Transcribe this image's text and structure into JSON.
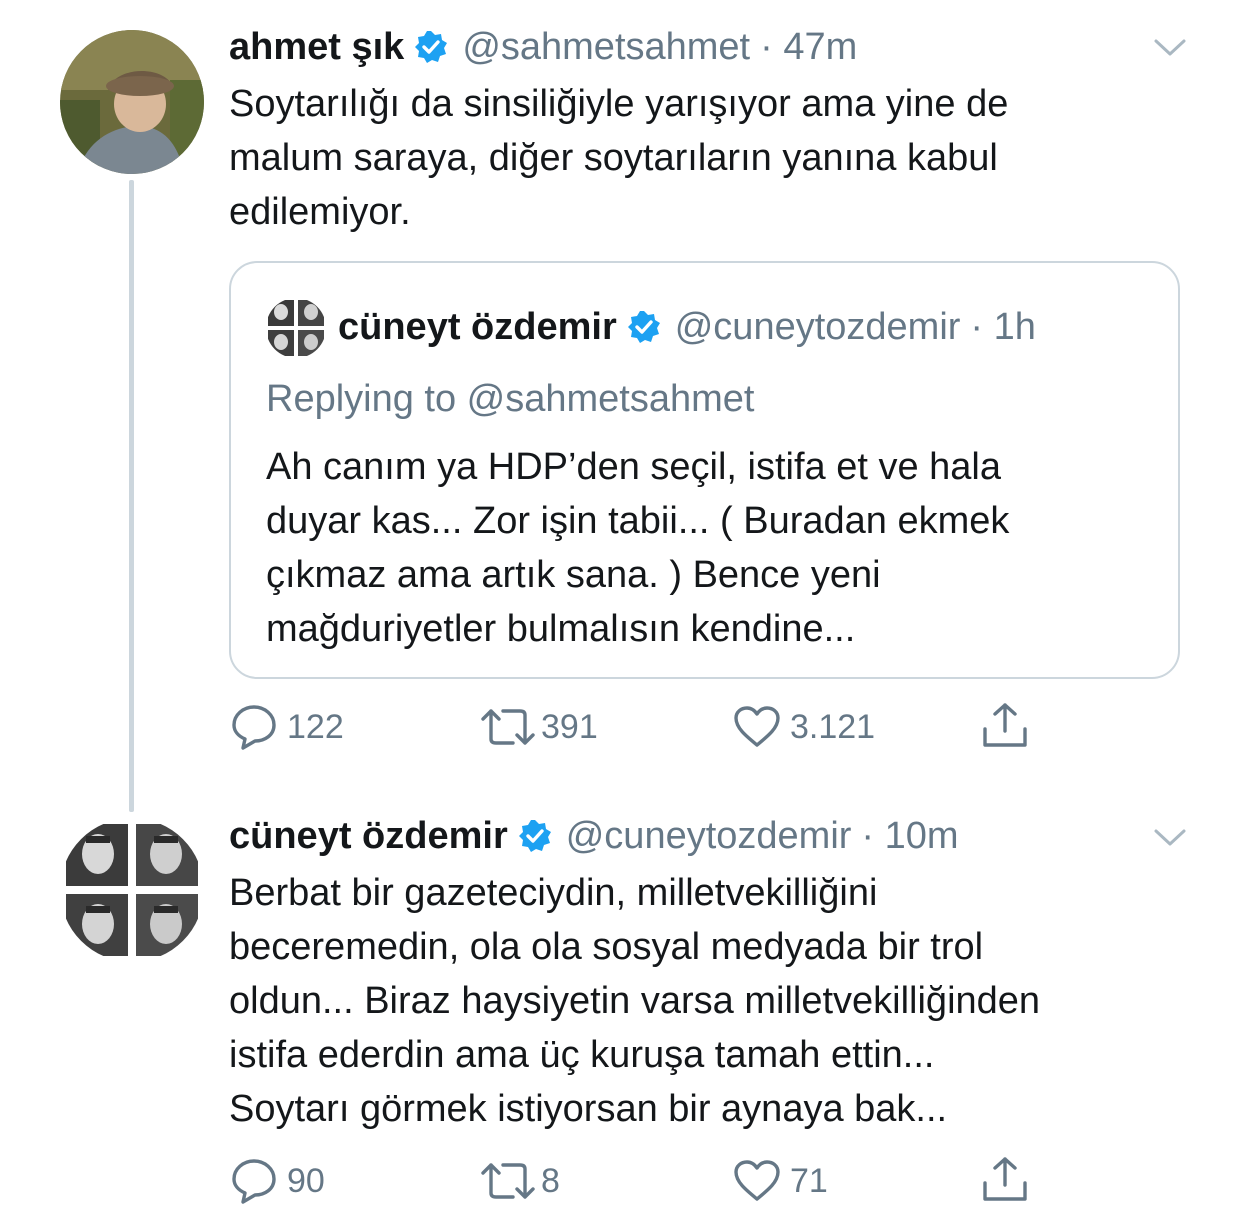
{
  "tweet1": {
    "name": "ahmet şık",
    "handle": "@sahmetsahmet",
    "time": "· 47m",
    "lines": [
      "Soytarılığı da sinsiliğiyle yarışıyor ama yine de",
      "malum saraya, diğer soytarıların yanına kabul",
      "edilemiyor."
    ],
    "quote": {
      "name": "cüneyt özdemir",
      "handle": "@cuneytozdemir",
      "time": "· 1h",
      "replying": "Replying to @sahmetsahmet",
      "lines": [
        "Ah canım ya HDP’den seçil, istifa et ve hala",
        "duyar kas... Zor işin tabii... ( Buradan ekmek",
        "çıkmaz ama artık sana. ) Bence yeni",
        "mağduriyetler bulmalısın kendine..."
      ]
    },
    "replies": "122",
    "retweets": "391",
    "likes": "3.121"
  },
  "tweet2": {
    "name": "cüneyt özdemir",
    "handle": "@cuneytozdemir",
    "time": "· 10m",
    "lines": [
      "Berbat bir gazeteciydin, milletvekilliğini",
      "beceremedin, ola ola sosyal medyada bir trol",
      "oldun... Biraz haysiyetin varsa milletvekilliğinden",
      "istifa ederdin ama üç kuruşa tamah ettin...",
      "Soytarı görmek istiyorsan bir aynaya bak..."
    ],
    "replies": "90",
    "retweets": "8",
    "likes": "71"
  },
  "icons": {
    "verified": "verified-badge-icon",
    "caret": "chevron-down-icon",
    "reply": "reply-icon",
    "retweet": "retweet-icon",
    "like": "heart-icon",
    "share": "share-icon"
  },
  "colors": {
    "text": "#14171a",
    "secondary": "#657786",
    "accent": "#1da1f2",
    "border": "#ccd6dd"
  }
}
